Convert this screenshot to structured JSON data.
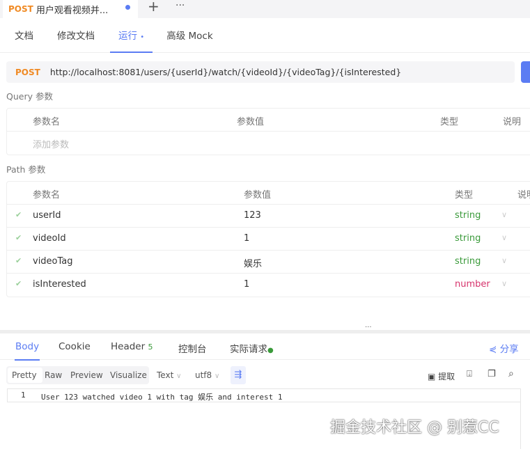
{
  "tab": {
    "method": "POST",
    "title": "用户观看视频并...",
    "add": "+",
    "more": "···"
  },
  "subtabs": [
    "文档",
    "修改文档",
    "运行",
    "高级 Mock"
  ],
  "run_dot": "•",
  "request": {
    "method": "POST",
    "url": "http://localhost:8081/users/{userId}/watch/{videoId}/{videoTag}/{isInterested}"
  },
  "query": {
    "title": "Query 参数",
    "headers": [
      "参数名",
      "参数值",
      "类型",
      "说明"
    ],
    "placeholder": "添加参数"
  },
  "path": {
    "title": "Path 参数",
    "headers": [
      "参数名",
      "参数值",
      "类型",
      "说明"
    ],
    "rows": [
      {
        "name": "userId",
        "value": "123",
        "type": "string"
      },
      {
        "name": "videoId",
        "value": "1",
        "type": "string"
      },
      {
        "name": "videoTag",
        "value": "娱乐",
        "type": "string"
      },
      {
        "name": "isInterested",
        "value": "1",
        "type": "number"
      }
    ]
  },
  "response": {
    "tabs": [
      "Body",
      "Cookie",
      "Header",
      "控制台",
      "实际请求"
    ],
    "header_count": "5",
    "share": "分享",
    "views": [
      "Pretty",
      "Raw",
      "Preview",
      "Visualize"
    ],
    "format": "Text",
    "encoding": "utf8",
    "extract": "提取",
    "line_no": "1",
    "body": "User 123 watched video 1 with tag 娱乐 and interest 1"
  },
  "watermark": "掘金技术社区 @ 别惹CC",
  "colors": {
    "accent": "#5b7cf3",
    "post": "#f08a24",
    "string": "#3a9a3a",
    "number": "#d6336c"
  }
}
